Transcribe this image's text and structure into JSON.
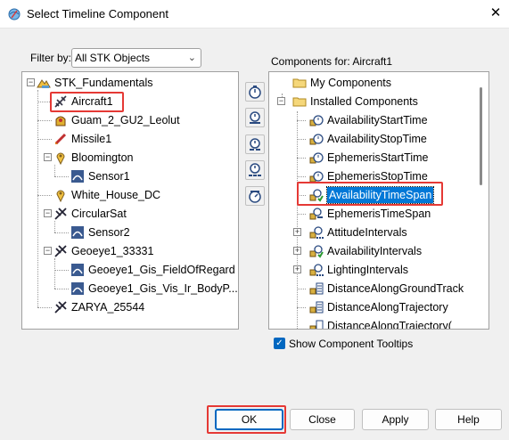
{
  "window": {
    "title": "Select Timeline Component",
    "close_glyph": "✕"
  },
  "filter": {
    "label": "Filter by:",
    "value": "All STK Objects"
  },
  "left_tree": [
    {
      "label": "STK_Fundamentals",
      "icon": "scenario-icon"
    },
    {
      "label": "Aircraft1",
      "icon": "aircraft-icon"
    },
    {
      "label": "Guam_2_GU2_Leolut",
      "icon": "facility-icon"
    },
    {
      "label": "Missile1",
      "icon": "missile-icon"
    },
    {
      "label": "Bloomington",
      "icon": "place-icon"
    },
    {
      "label": "Sensor1",
      "icon": "sensor-icon"
    },
    {
      "label": "White_House_DC",
      "icon": "place-icon"
    },
    {
      "label": "CircularSat",
      "icon": "satellite-icon"
    },
    {
      "label": "Sensor2",
      "icon": "sensor-icon"
    },
    {
      "label": "Geoeye1_33331",
      "icon": "satellite-icon"
    },
    {
      "label": "Geoeye1_Gis_FieldOfRegard",
      "icon": "sensor-icon"
    },
    {
      "label": "Geoeye1_Gis_Vis_Ir_BodyP...",
      "icon": "sensor-icon"
    },
    {
      "label": "ZARYA_25544",
      "icon": "satellite-icon"
    }
  ],
  "components_for": "Components for: Aircraft1",
  "right_tree": [
    {
      "label": "My Components",
      "icon": "folder-icon"
    },
    {
      "label": "Installed Components",
      "icon": "folder-icon"
    },
    {
      "label": "AvailabilityStartTime",
      "icon": "time-instant-icon"
    },
    {
      "label": "AvailabilityStopTime",
      "icon": "time-instant-icon"
    },
    {
      "label": "EphemerisStartTime",
      "icon": "time-instant-icon"
    },
    {
      "label": "EphemerisStopTime",
      "icon": "time-instant-icon"
    },
    {
      "label": "AvailabilityTimeSpan",
      "icon": "time-span-icon"
    },
    {
      "label": "EphemerisTimeSpan",
      "icon": "time-span-icon"
    },
    {
      "label": "AttitudeIntervals",
      "icon": "interval-list-icon"
    },
    {
      "label": "AvailabilityIntervals",
      "icon": "interval-list-icon"
    },
    {
      "label": "LightingIntervals",
      "icon": "interval-list-icon"
    },
    {
      "label": "DistanceAlongGroundTrack",
      "icon": "calc-scalar-icon"
    },
    {
      "label": "DistanceAlongTrajectory",
      "icon": "calc-scalar-icon"
    },
    {
      "label": "DistanceAlongTrajectory(",
      "icon": "calc-scalar-icon"
    }
  ],
  "tooltips_checkbox": {
    "label": "Show Component Tooltips",
    "checked": true
  },
  "buttons": {
    "ok": "OK",
    "close": "Close",
    "apply": "Apply",
    "help": "Help"
  },
  "colors": {
    "selection": "#0078d7",
    "highlight": "#e53935",
    "accent": "#0067c0"
  }
}
